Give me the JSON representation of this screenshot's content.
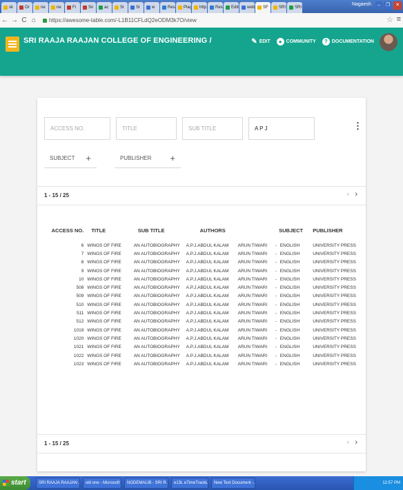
{
  "browser": {
    "tabs": [
      {
        "label": "sk",
        "color": "#f0b400"
      },
      {
        "label": "Or",
        "color": "#c0392b"
      },
      {
        "label": "ne",
        "color": "#f0b400"
      },
      {
        "label": "ne",
        "color": "#f0b400"
      },
      {
        "label": "Fi",
        "color": "#c0392b"
      },
      {
        "label": "Sn",
        "color": "#c0392b"
      },
      {
        "label": "ac",
        "color": "#1f9c4b"
      },
      {
        "label": "Sr",
        "color": "#f0b400"
      },
      {
        "label": "Sr",
        "color": "#3a6fd8"
      },
      {
        "label": "w",
        "color": "#3a6fd8"
      },
      {
        "label": "Rese",
        "color": "#2a7ad8"
      },
      {
        "label": "Plagi",
        "color": "#f0b400"
      },
      {
        "label": "http:",
        "color": "#f0b400"
      },
      {
        "label": "Rese",
        "color": "#2a7ad8"
      },
      {
        "label": "Editio",
        "color": "#1f9c4b"
      },
      {
        "label": "websi",
        "color": "#3a6fd8"
      },
      {
        "label": "SF",
        "color": "#f0b400",
        "active": true
      },
      {
        "label": "SRI",
        "color": "#f0b400"
      },
      {
        "label": "SRI",
        "color": "#1f9c4b"
      }
    ],
    "profile": "Nagaesh",
    "url": "https://awesome-table.com/-L1B11CFLdQ2eODM3k7O/view"
  },
  "app": {
    "title": "SRI RAAJA RAAJAN COLLEGE OF ENGINEERING /",
    "nav": [
      {
        "label": "EDIT",
        "icon": "pencil-icon"
      },
      {
        "label": "COMMUNITY",
        "icon": "community-icon"
      },
      {
        "label": "DOCUMENTATION",
        "icon": "help-icon"
      }
    ]
  },
  "filters": {
    "access_no": {
      "placeholder": "ACCESS NO.",
      "value": ""
    },
    "title": {
      "placeholder": "TITLE",
      "value": ""
    },
    "sub_title": {
      "placeholder": "SUB TITLE",
      "value": ""
    },
    "search": {
      "placeholder": "",
      "value": "A P J"
    },
    "subject": {
      "label": "SUBJECT",
      "plus": "+"
    },
    "publisher": {
      "label": "PUBLISHER",
      "plus": "+"
    }
  },
  "pagination": {
    "range": "1 - 15 / 25",
    "prev": "‹",
    "next": "›"
  },
  "table": {
    "headers": [
      "ACCESS NO.",
      "TITLE",
      "SUB TITLE",
      "AUTHORS",
      "",
      "SUBJECT",
      "PUBLISHER"
    ],
    "rows": [
      [
        "6",
        "WINGS OF FIRE",
        "AN AUTOBIOGRAPHY",
        "A.P.J.ABDUL KALAM",
        "ARUN TIWARI",
        "-",
        "ENGLISH",
        "UNIVERSITY PRESS"
      ],
      [
        "7",
        "WINGS OF FIRE",
        "AN AUTOBIOGRAPHY",
        "A.P.J.ABDUL KALAM",
        "ARUN TIWARI",
        "-",
        "ENGLISH",
        "UNIVERSITY PRESS"
      ],
      [
        "8",
        "WINGS OF FIRE",
        "AN AUTOBIOGRAPHY",
        "A.P.J.ABDUL KALAM",
        "ARUN TIWARI",
        "-",
        "ENGLISH",
        "UNIVERSITY PRESS"
      ],
      [
        "9",
        "WINGS OF FIRE",
        "AN AUTOBIOGRAPHY",
        "A.P.J.ABDUL KALAM",
        "ARUN TIWARI",
        "-",
        "ENGLISH",
        "UNIVERSITY PRESS"
      ],
      [
        "10",
        "WINGS OF FIRE",
        "AN AUTOBIOGRAPHY",
        "A.P.J.ABDUL KALAM",
        "ARUN TIWARI",
        "-",
        "ENGLISH",
        "UNIVERSITY PRESS"
      ],
      [
        "508",
        "WINGS OF FIRE",
        "AN AUTOBIOGRAPHY",
        "A.P.J.ABDUL KALAM",
        "ARUN TIWARI",
        "-",
        "ENGLISH",
        "UNIVERSITY PRESS"
      ],
      [
        "509",
        "WINGS OF FIRE",
        "AN AUTOBIOGRAPHY",
        "A.P.J.ABDUL KALAM",
        "ARUN TIWARI",
        "-",
        "ENGLISH",
        "UNIVERSITY PRESS"
      ],
      [
        "510",
        "WINGS OF FIRE",
        "AN AUTOBIOGRAPHY",
        "A.P.J.ABDUL KALAM",
        "ARUN TIWARI",
        "-",
        "ENGLISH",
        "UNIVERSITY PRESS"
      ],
      [
        "511",
        "WINGS OF FIRE",
        "AN AUTOBIOGRAPHY",
        "A.P.J.ABDUL KALAM",
        "ARUN TIWARI",
        "-",
        "ENGLISH",
        "UNIVERSITY PRESS"
      ],
      [
        "512",
        "WINGS OF FIRE",
        "AN AUTOBIOGRAPHY",
        "A.P.J.ABDUL KALAM",
        "ARUN TIWARI",
        "-",
        "ENGLISH",
        "UNIVERSITY PRESS"
      ],
      [
        "1019",
        "WINGS OF FIRE",
        "AN AUTOBIOGRAPHY",
        "A.P.J.ABDUL KALAM",
        "ARUN TIWARI",
        "-",
        "ENGLISH",
        "UNIVERSITY PRESS"
      ],
      [
        "1020",
        "WINGS OF FIRE",
        "AN AUTOBIOGRAPHY",
        "A.P.J.ABDUL KALAM",
        "ARUN TIWARI",
        "-",
        "ENGLISH",
        "UNIVERSITY PRESS"
      ],
      [
        "1021",
        "WINGS OF FIRE",
        "AN AUTOBIOGRAPHY",
        "A.P.J.ABDUL KALAM",
        "ARUN TIWARI",
        "-",
        "ENGLISH",
        "UNIVERSITY PRESS"
      ],
      [
        "1022",
        "WINGS OF FIRE",
        "AN AUTOBIOGRAPHY",
        "A.P.J.ABDUL KALAM",
        "ARUN TIWARI",
        "-",
        "ENGLISH",
        "UNIVERSITY PRESS"
      ],
      [
        "1023",
        "WINGS OF FIRE",
        "AN AUTOBIOGRAPHY",
        "A.P.J.ABDUL KALAM",
        "ARUN TIWARI",
        "-",
        "ENGLISH",
        "UNIVERSITY PRESS"
      ]
    ]
  },
  "taskbar": {
    "start": "start",
    "tasks": [
      "SRI RAAJA RAAJAN ...",
      "old one - Microsoft W...",
      "NODEMALIB - SRI R...",
      "e13L eTimeTrackLite ...",
      "New Text Document -..."
    ],
    "clock": "12:57 PM"
  },
  "colors": {
    "header": "#15a58f",
    "logo": "#f5b51e"
  }
}
